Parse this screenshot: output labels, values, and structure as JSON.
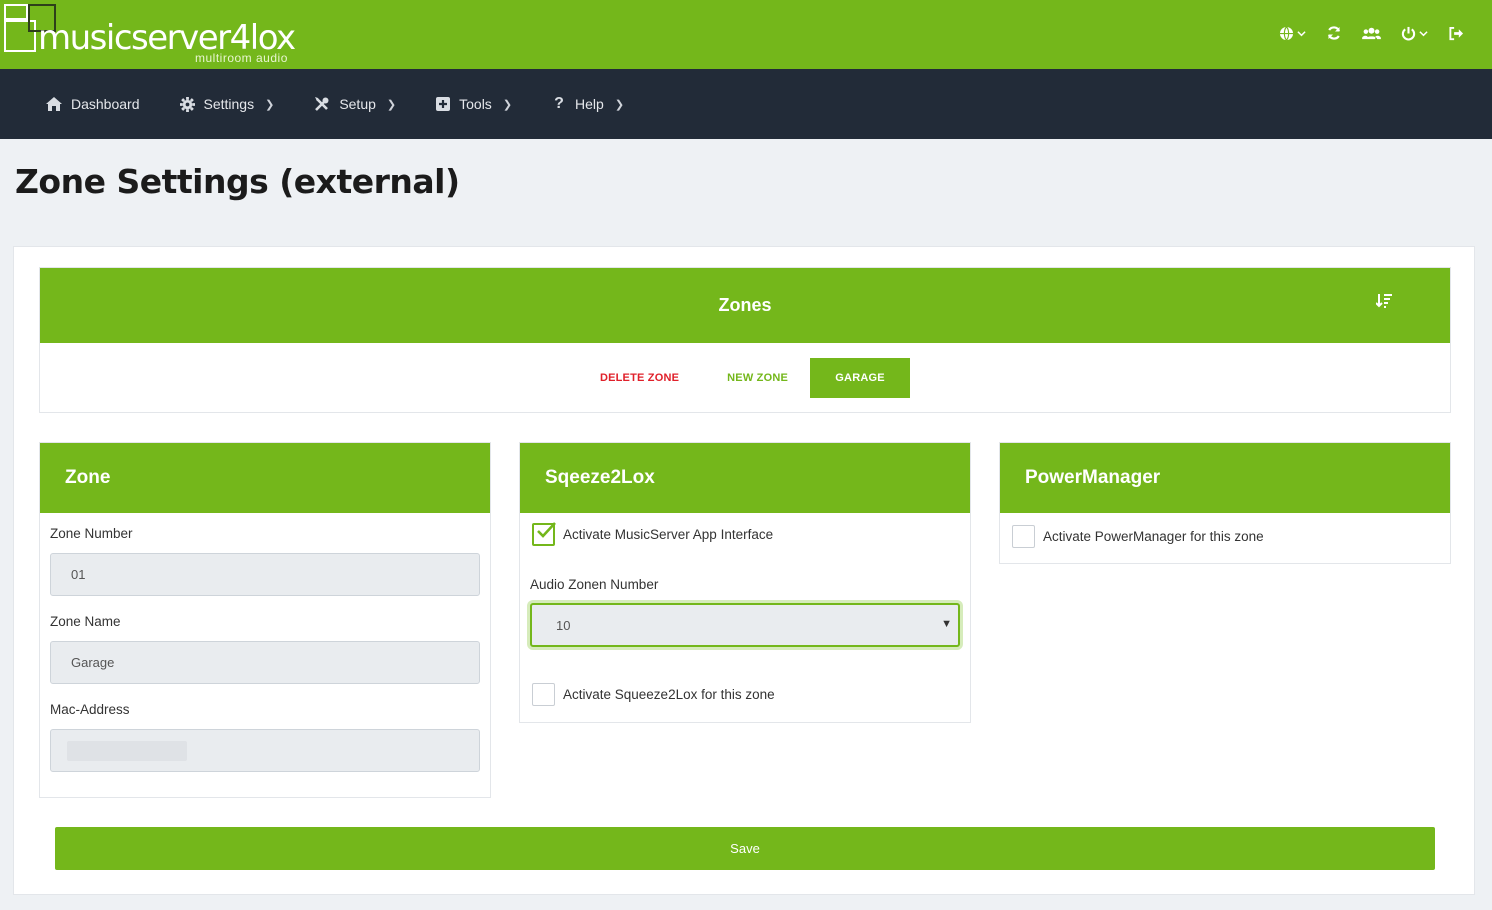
{
  "brand": {
    "name": "musicserver4lox",
    "tagline": "multiroom audio"
  },
  "colors": {
    "accent": "#74b71b",
    "nav_bg": "#222b38",
    "danger": "#e0202a",
    "page_bg": "#eef1f4"
  },
  "top_icons": [
    "globe-icon",
    "refresh-icon",
    "users-icon",
    "power-icon",
    "logout-icon"
  ],
  "nav": {
    "items": [
      {
        "label": "Dashboard",
        "icon": "home-icon"
      },
      {
        "label": "Settings",
        "icon": "gear-icon"
      },
      {
        "label": "Setup",
        "icon": "tools-icon"
      },
      {
        "label": "Tools",
        "icon": "plus-square-icon"
      },
      {
        "label": "Help",
        "icon": "question-icon"
      }
    ]
  },
  "page": {
    "title": "Zone Settings (external)"
  },
  "zones": {
    "title": "Zones",
    "delete_label": "DELETE ZONE",
    "new_label": "NEW ZONE",
    "selected_zone": "GARAGE"
  },
  "zone_panel": {
    "title": "Zone",
    "number_label": "Zone Number",
    "number_value": "01",
    "name_label": "Zone Name",
    "name_value": "Garage",
    "mac_label": "Mac-Address"
  },
  "squeeze_panel": {
    "title": "Sqeeze2Lox",
    "app_interface_label": "Activate MusicServer App Interface",
    "app_interface_checked": true,
    "audio_zone_label": "Audio Zonen Number",
    "audio_zone_value": "10",
    "activate_label": "Activate Squeeze2Lox for this zone",
    "activate_checked": false
  },
  "power_panel": {
    "title": "PowerManager",
    "activate_label": "Activate PowerManager for this zone",
    "activate_checked": false
  },
  "save_label": "Save"
}
